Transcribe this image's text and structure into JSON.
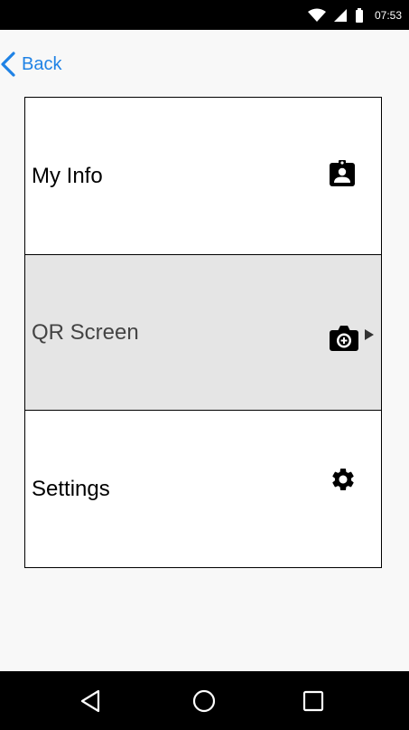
{
  "status_bar": {
    "time": "07:53",
    "icons": [
      "wifi-icon",
      "signal-icon",
      "battery-icon"
    ]
  },
  "header": {
    "back_label": "Back",
    "accent_color": "#1f82e5"
  },
  "menu": {
    "items": [
      {
        "label": "My Info",
        "icon": "contact-badge-icon",
        "selected": false
      },
      {
        "label": "QR Screen",
        "icon": "camera-icon",
        "selected": true
      },
      {
        "label": "Settings",
        "icon": "gear-icon",
        "selected": false
      }
    ],
    "selected_background": "#e5e5e5"
  },
  "nav_bar": {
    "buttons": [
      "back-triangle-icon",
      "home-circle-icon",
      "recents-square-icon"
    ]
  }
}
